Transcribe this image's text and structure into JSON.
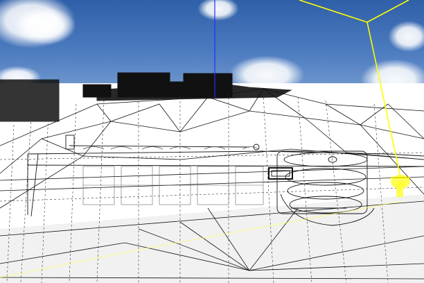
{
  "scene": {
    "sky_color": "#2f5fa8",
    "gizmo_axis_color": "#2a2aff",
    "selection_color": "#ffff00",
    "wireframe_color": "#111111"
  },
  "icons": {
    "selected_object": "selected-object-handle-icon"
  }
}
